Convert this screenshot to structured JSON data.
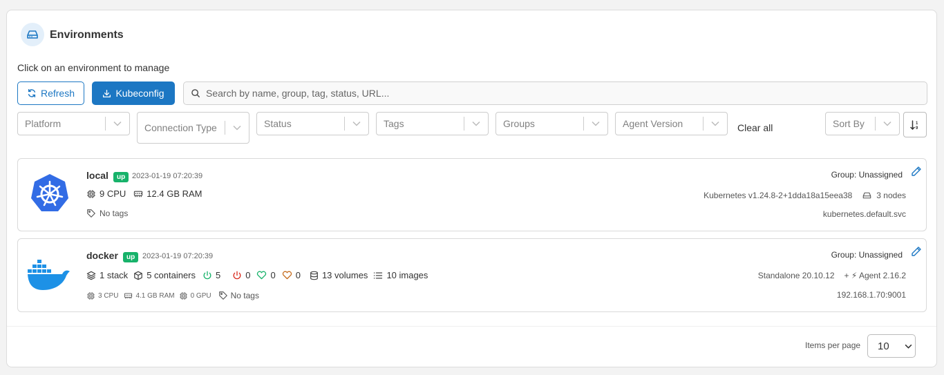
{
  "header": {
    "title": "Environments",
    "subtitle": "Click on an environment to manage"
  },
  "actions": {
    "refresh_label": "Refresh",
    "kubeconfig_label": "Kubeconfig"
  },
  "search": {
    "placeholder": "Search by name, group, tag, status, URL..."
  },
  "filters": {
    "platform": "Platform",
    "connection_type": "Connection Type",
    "status": "Status",
    "tags": "Tags",
    "groups": "Groups",
    "agent_version": "Agent Version",
    "clear_all": "Clear all",
    "sort_by": "Sort By"
  },
  "environments": [
    {
      "name": "local",
      "status": "up",
      "timestamp": "2023-01-19 07:20:39",
      "cpu": "9 CPU",
      "ram": "12.4 GB RAM",
      "tags": "No tags",
      "group": "Group: Unassigned",
      "platform_info": "Kubernetes v1.24.8-2+1dda18a15eea38",
      "nodes": "3 nodes",
      "url": "kubernetes.default.svc"
    },
    {
      "name": "docker",
      "status": "up",
      "timestamp": "2023-01-19 07:20:39",
      "stacks": "1 stack",
      "containers": "5 containers",
      "running": "5",
      "stopped": "0",
      "healthy": "0",
      "unhealthy": "0",
      "volumes": "13 volumes",
      "images": "10 images",
      "cpu": "3 CPU",
      "ram": "4.1 GB RAM",
      "gpu": "0 GPU",
      "tags": "No tags",
      "group": "Group: Unassigned",
      "platform_info": "Standalone 20.10.12",
      "agent": "+ ⚡ Agent 2.16.2",
      "url": "192.168.1.70:9001"
    }
  ],
  "pagination": {
    "label": "Items per page",
    "value": "10"
  },
  "colors": {
    "accent": "#1c77c3",
    "up_badge": "#17b26a",
    "kubernetes": "#326ce5",
    "docker": "#1d91e6"
  }
}
